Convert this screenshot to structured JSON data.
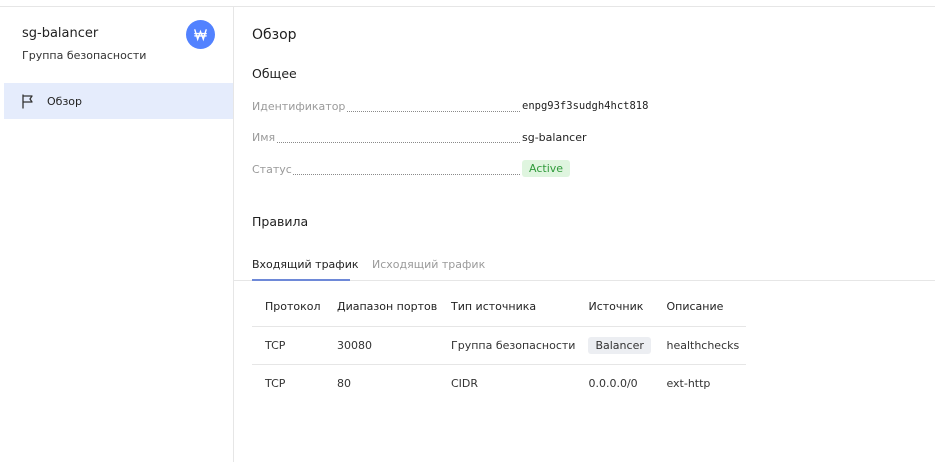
{
  "sidebar": {
    "title": "sg-balancer",
    "subtitle": "Группа безопасности",
    "badge_icon": "security-group-icon",
    "badge_color": "#5282ff",
    "items": [
      {
        "label": "Обзор",
        "icon": "flag-icon",
        "active": true
      }
    ]
  },
  "main": {
    "title": "Обзор",
    "general": {
      "heading": "Общее",
      "fields": [
        {
          "key": "Идентификатор",
          "value": "enpg93f3sudgh4hct818"
        },
        {
          "key": "Имя",
          "value": "sg-balancer"
        },
        {
          "key": "Статус",
          "value": "Active"
        }
      ],
      "status_color": "#2f9a3a"
    },
    "rules": {
      "heading": "Правила",
      "tabs": [
        {
          "label": "Входящий трафик",
          "active": true
        },
        {
          "label": "Исходящий трафик",
          "active": false
        }
      ],
      "columns": [
        "Протокол",
        "Диапазон портов",
        "Тип источника",
        "Источник",
        "Описание"
      ],
      "rows": [
        {
          "protocol": "TCP",
          "ports": "30080",
          "source_type": "Группа безопасности",
          "source": "Balancer",
          "description": "healthchecks"
        },
        {
          "protocol": "TCP",
          "ports": "80",
          "source_type": "CIDR",
          "source": "0.0.0.0/0",
          "description": "ext-http"
        }
      ]
    }
  }
}
